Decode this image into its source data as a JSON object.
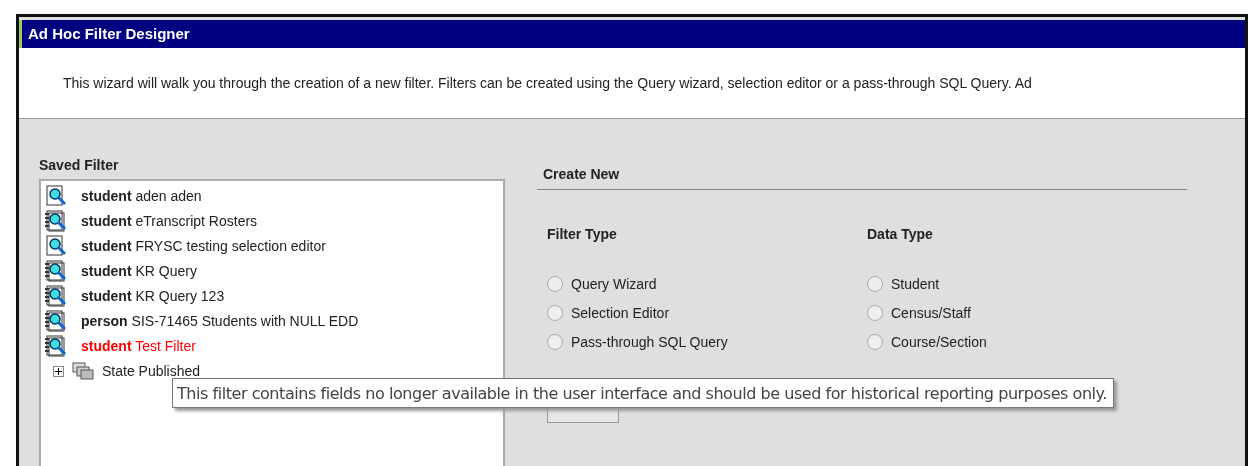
{
  "window": {
    "title": "Ad Hoc Filter Designer"
  },
  "description": "This wizard will walk you through the creation of a new filter. Filters can be created using the Query wizard, selection editor or a pass-through SQL Query. Ad",
  "saved_filter": {
    "title": "Saved Filter",
    "items": [
      {
        "kind": "page",
        "type": "student",
        "name": "aden aden",
        "flagged": false
      },
      {
        "kind": "notebook",
        "type": "student",
        "name": "eTranscript Rosters",
        "flagged": false
      },
      {
        "kind": "page",
        "type": "student",
        "name": "FRYSC testing selection editor",
        "flagged": false
      },
      {
        "kind": "notebook",
        "type": "student",
        "name": "KR Query",
        "flagged": false
      },
      {
        "kind": "notebook",
        "type": "student",
        "name": "KR Query 123",
        "flagged": false
      },
      {
        "kind": "notebook",
        "type": "person",
        "name": "SIS-71465 Students with NULL EDD",
        "flagged": false
      },
      {
        "kind": "notebook",
        "type": "student",
        "name": "Test Filter",
        "flagged": true
      }
    ],
    "folders": [
      {
        "label": "State Published",
        "expanded": false
      }
    ]
  },
  "create_new": {
    "title": "Create New",
    "filter_type": {
      "title": "Filter Type",
      "options": [
        {
          "label": "Query Wizard",
          "selected": false
        },
        {
          "label": "Selection Editor",
          "selected": false
        },
        {
          "label": "Pass-through SQL Query",
          "selected": false
        }
      ]
    },
    "data_type": {
      "title": "Data Type",
      "options": [
        {
          "label": "Student",
          "selected": false
        },
        {
          "label": "Census/Staff",
          "selected": false
        },
        {
          "label": "Course/Section",
          "selected": false
        }
      ]
    }
  },
  "tooltip": "This filter contains fields no longer available in the user interface and should be used for historical reporting purposes only."
}
